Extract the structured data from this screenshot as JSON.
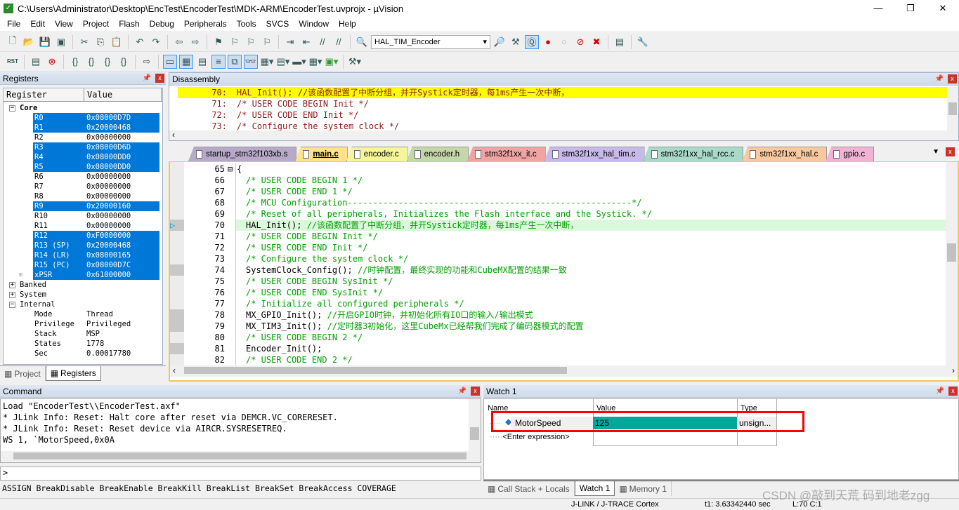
{
  "window": {
    "title": "C:\\Users\\Administrator\\Desktop\\EncTest\\EncoderTest\\MDK-ARM\\EncoderTest.uvprojx - µVision",
    "minimize": "—",
    "maximize": "❐",
    "close": "✕"
  },
  "menu": [
    "File",
    "Edit",
    "View",
    "Project",
    "Flash",
    "Debug",
    "Peripherals",
    "Tools",
    "SVCS",
    "Window",
    "Help"
  ],
  "toolbar": {
    "target_select": "HAL_TIM_Encoder",
    "rst_label": "RST"
  },
  "registers": {
    "title": "Registers",
    "col_register": "Register",
    "col_value": "Value",
    "core_label": "Core",
    "core": [
      {
        "name": "R0",
        "value": "0x08000D7D",
        "selected": true
      },
      {
        "name": "R1",
        "value": "0x20000468",
        "selected": true
      },
      {
        "name": "R2",
        "value": "0x00000000",
        "selected": false
      },
      {
        "name": "R3",
        "value": "0x08000D6D",
        "selected": true
      },
      {
        "name": "R4",
        "value": "0x08000DD0",
        "selected": true
      },
      {
        "name": "R5",
        "value": "0x08000DD0",
        "selected": true
      },
      {
        "name": "R6",
        "value": "0x00000000",
        "selected": false
      },
      {
        "name": "R7",
        "value": "0x00000000",
        "selected": false
      },
      {
        "name": "R8",
        "value": "0x00000000",
        "selected": false
      },
      {
        "name": "R9",
        "value": "0x20000160",
        "selected": true
      },
      {
        "name": "R10",
        "value": "0x00000000",
        "selected": false
      },
      {
        "name": "R11",
        "value": "0x00000000",
        "selected": false
      },
      {
        "name": "R12",
        "value": "0xF0000000",
        "selected": true
      },
      {
        "name": "R13 (SP)",
        "value": "0x20000468",
        "selected": true
      },
      {
        "name": "R14 (LR)",
        "value": "0x08000165",
        "selected": true
      },
      {
        "name": "R15 (PC)",
        "value": "0x08000D7C",
        "selected": true
      },
      {
        "name": "xPSR",
        "value": "0x61000000",
        "selected": true
      }
    ],
    "groups": [
      "Banked",
      "System"
    ],
    "internal_label": "Internal",
    "internal": [
      {
        "name": "Mode",
        "value": "Thread"
      },
      {
        "name": "Privilege",
        "value": "Privileged"
      },
      {
        "name": "Stack",
        "value": "MSP"
      },
      {
        "name": "States",
        "value": "1778"
      },
      {
        "name": "Sec",
        "value": "0.00017780"
      }
    ],
    "tabs": [
      {
        "label": "Project",
        "active": false
      },
      {
        "label": "Registers",
        "active": true
      }
    ]
  },
  "disassembly": {
    "title": "Disassembly",
    "lines": [
      {
        "num": "70:",
        "text": "HAL_Init(); //该函数配置了中断分组，并开Systick定时器，每1ms产生一次中断，",
        "current": true
      },
      {
        "num": "71:",
        "text": "/* USER CODE BEGIN Init */",
        "current": false
      },
      {
        "num": "72:",
        "text": "/* USER CODE END Init */",
        "current": false
      },
      {
        "num": "73:",
        "text": "/* Configure the system clock */",
        "current": false
      }
    ]
  },
  "editor": {
    "tabs": [
      {
        "label": "startup_stm32f103xb.s",
        "color": "#b8a9c9",
        "active": false
      },
      {
        "label": "main.c",
        "color": "#ffe28a",
        "active": true
      },
      {
        "label": "encoder.c",
        "color": "#f5f59a",
        "active": false
      },
      {
        "label": "encoder.h",
        "color": "#c5d6a8",
        "active": false
      },
      {
        "label": "stm32f1xx_it.c",
        "color": "#efa3a3",
        "active": false
      },
      {
        "label": "stm32f1xx_hal_tim.c",
        "color": "#c9b9ea",
        "active": false
      },
      {
        "label": "stm32f1xx_hal_rcc.c",
        "color": "#a9d9c9",
        "active": false
      },
      {
        "label": "stm32f1xx_hal.c",
        "color": "#f8c89e",
        "active": false
      },
      {
        "label": "gpio.c",
        "color": "#f0b3d3",
        "active": false
      }
    ],
    "lines": [
      {
        "num": "65",
        "code": "{",
        "comment": "",
        "fold": true
      },
      {
        "num": "66",
        "code": "",
        "comment": "/* USER CODE BEGIN 1 */"
      },
      {
        "num": "67",
        "code": "",
        "comment": "/* USER CODE END 1 */"
      },
      {
        "num": "68",
        "code": "",
        "comment": "/* MCU Configuration--------------------------------------------------------*/"
      },
      {
        "num": "69",
        "code": "",
        "comment": "/* Reset of all peripherals, Initializes the Flash interface and the Systick. */"
      },
      {
        "num": "70",
        "code": "HAL_Init(); ",
        "comment": "//该函数配置了中断分组，并开Systick定时器，每1ms产生一次中断，",
        "current": true,
        "gutter": true
      },
      {
        "num": "71",
        "code": "",
        "comment": "/* USER CODE BEGIN Init */"
      },
      {
        "num": "72",
        "code": "",
        "comment": "/* USER CODE END Init */"
      },
      {
        "num": "73",
        "code": "",
        "comment": "/* Configure the system clock */"
      },
      {
        "num": "74",
        "code": "SystemClock_Config(); ",
        "comment": "//时钟配置，最终实现的功能和CubeMX配置的结果一致",
        "gutter": true
      },
      {
        "num": "75",
        "code": "",
        "comment": "/* USER CODE BEGIN SysInit */"
      },
      {
        "num": "76",
        "code": "",
        "comment": "/* USER CODE END SysInit */"
      },
      {
        "num": "77",
        "code": "",
        "comment": "/* Initialize all configured peripherals */"
      },
      {
        "num": "78",
        "code": "MX_GPIO_Init(); ",
        "comment": "//开启GPIO时钟，并初始化所有IO口的输入/输出模式",
        "gutter": true
      },
      {
        "num": "79",
        "code": "MX_TIM3_Init(); ",
        "comment": "//定时器3初始化，这里CubeMx已经帮我们完成了编码器模式的配置",
        "gutter": true
      },
      {
        "num": "80",
        "code": "",
        "comment": "/* USER CODE BEGIN 2 */"
      },
      {
        "num": "81",
        "code": "Encoder_Init();",
        "comment": "",
        "gutter": true
      },
      {
        "num": "82",
        "code": "",
        "comment": "/* USER CODE END 2 */"
      }
    ]
  },
  "command": {
    "title": "Command",
    "output": [
      "Load \"EncoderTest\\\\EncoderTest.axf\"",
      "* JLink Info: Reset: Halt core after reset via DEMCR.VC_CORERESET.",
      "* JLink Info: Reset: Reset device via AIRCR.SYSRESETREQ.",
      "WS 1, `MotorSpeed,0x0A"
    ],
    "prompt": ">",
    "hints": "ASSIGN BreakDisable BreakEnable BreakKill BreakList BreakSet BreakAccess COVERAGE"
  },
  "watch": {
    "title": "Watch 1",
    "col_name": "Name",
    "col_value": "Value",
    "col_type": "Type",
    "rows": [
      {
        "name": "MotorSpeed",
        "value": "125",
        "type": "unsign..."
      }
    ],
    "enter_expression": "<Enter expression>",
    "highlight_color": "#00a89a",
    "annotation_color": "#ff0000",
    "tabs": [
      {
        "label": "Call Stack + Locals",
        "active": false
      },
      {
        "label": "Watch 1",
        "active": true
      },
      {
        "label": "Memory 1",
        "active": false
      }
    ]
  },
  "status": {
    "debugger": "J-LINK / J-TRACE Cortex",
    "time": "t1: 3.63342440 sec",
    "position": "L:70 C:1"
  },
  "watermark": "CSDN @敲到天荒 码到地老zgg"
}
